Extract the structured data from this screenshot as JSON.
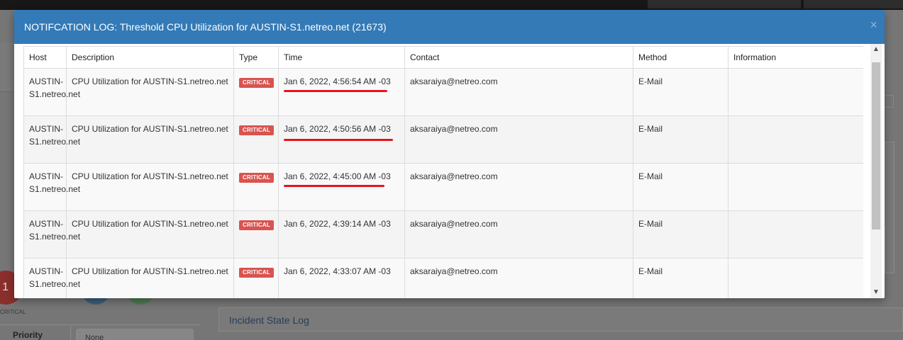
{
  "modal": {
    "title": "NOTIFCATION LOG: Threshold CPU Utilization for AUSTIN-S1.netreo.net (21673)",
    "close_glyph": "×"
  },
  "table": {
    "headers": [
      "Host",
      "Description",
      "Type",
      "Time",
      "Contact",
      "Method",
      "Information"
    ],
    "rows": [
      {
        "host": "AUSTIN-S1.netreo.net",
        "description": "CPU Utilization for AUSTIN-S1.netreo.net",
        "type": "CRITICAL",
        "time": "Jan 6, 2022, 4:56:54 AM -03",
        "contact": "aksaraiya@netreo.com",
        "method": "E-Mail",
        "information": ""
      },
      {
        "host": "AUSTIN-S1.netreo.net",
        "description": "CPU Utilization for AUSTIN-S1.netreo.net",
        "type": "CRITICAL",
        "time": "Jan 6, 2022, 4:50:56 AM -03",
        "contact": "aksaraiya@netreo.com",
        "method": "E-Mail",
        "information": ""
      },
      {
        "host": "AUSTIN-S1.netreo.net",
        "description": "CPU Utilization for AUSTIN-S1.netreo.net",
        "type": "CRITICAL",
        "time": "Jan 6, 2022, 4:45:00 AM -03",
        "contact": "aksaraiya@netreo.com",
        "method": "E-Mail",
        "information": ""
      },
      {
        "host": "AUSTIN-S1.netreo.net",
        "description": "CPU Utilization for AUSTIN-S1.netreo.net",
        "type": "CRITICAL",
        "time": "Jan 6, 2022, 4:39:14 AM -03",
        "contact": "aksaraiya@netreo.com",
        "method": "E-Mail",
        "information": ""
      },
      {
        "host": "AUSTIN-S1.netreo.net",
        "description": "CPU Utilization for AUSTIN-S1.netreo.net",
        "type": "CRITICAL",
        "time": "Jan 6, 2022, 4:33:07 AM -03",
        "contact": "aksaraiya@netreo.com",
        "method": "E-Mail",
        "information": ""
      }
    ]
  },
  "background": {
    "incident_state_log": "Incident State Log",
    "priority_label": "Priority",
    "priority_value": "None",
    "critical_label": "CRITICAL",
    "critical_count": "1"
  },
  "colors": {
    "modal_header": "#337ab7",
    "badge_critical": "#d9534f",
    "annotation_red": "#e8131a"
  },
  "icons": {
    "close": "close-icon",
    "scroll_up": "chevron-up-icon",
    "scroll_down": "chevron-down-icon"
  }
}
